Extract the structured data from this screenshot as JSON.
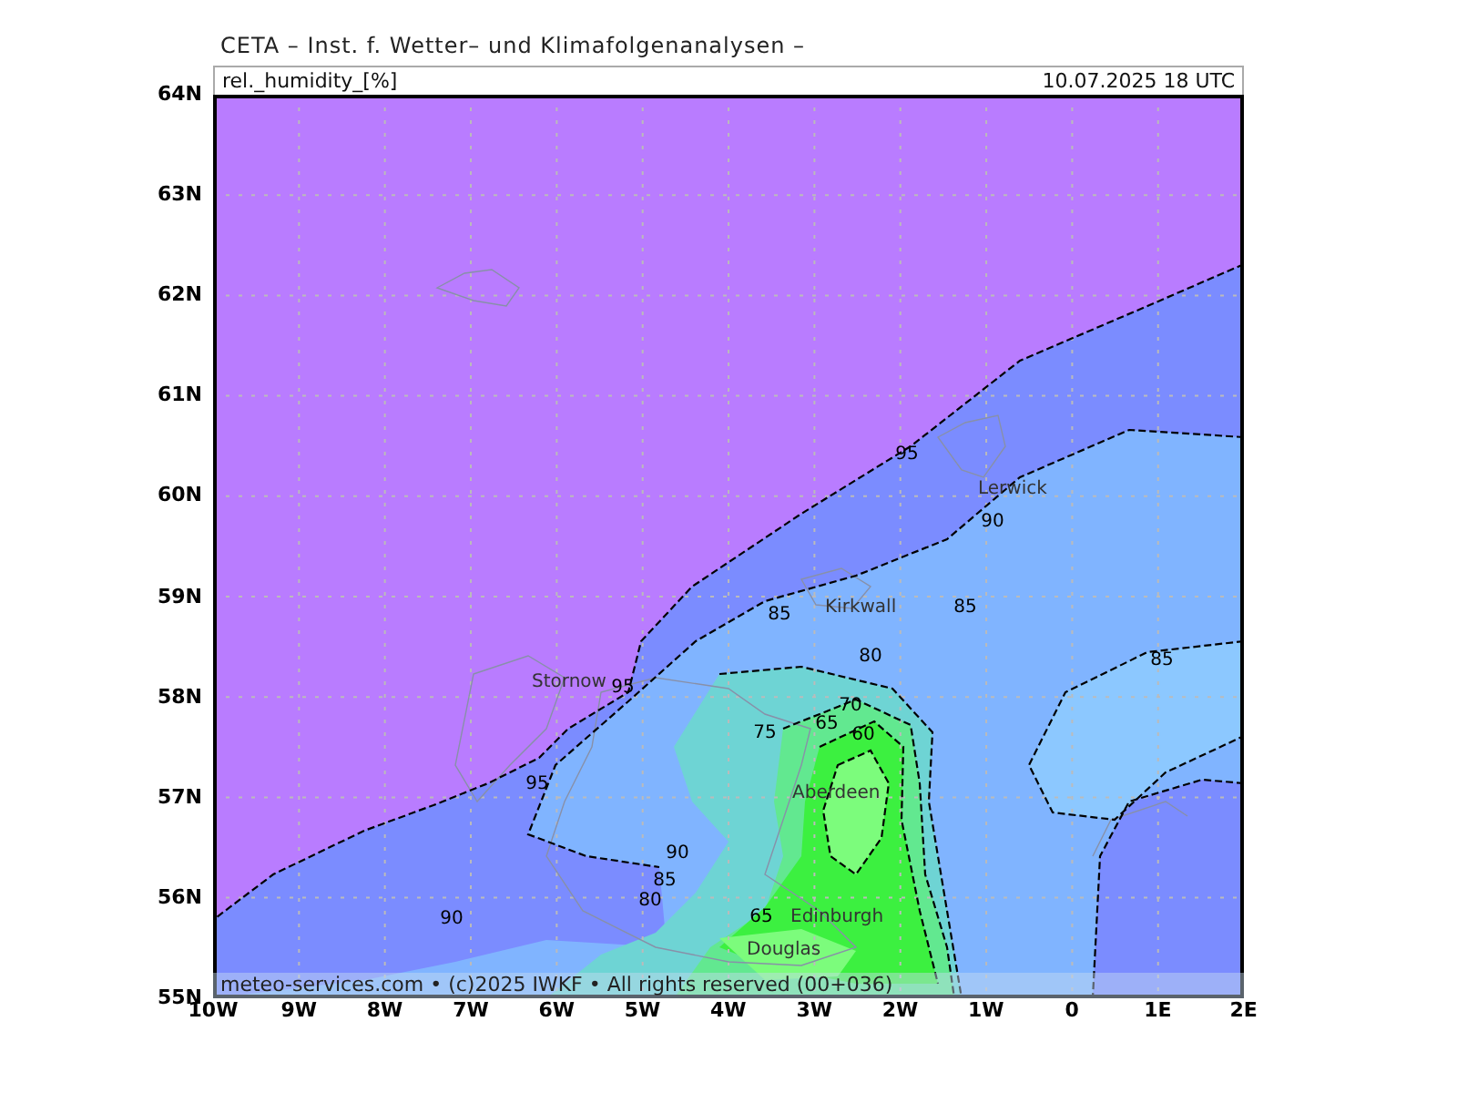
{
  "header": {
    "institute": "CETA – Inst. f. Wetter– und Klimafolgenanalysen –",
    "parameter": "rel._humidity_[%]",
    "valid_time": "10.07.2025 18 UTC"
  },
  "map": {
    "lat_labels": [
      "64N",
      "63N",
      "62N",
      "61N",
      "60N",
      "59N",
      "58N",
      "57N",
      "56N",
      "55N"
    ],
    "lon_labels": [
      "10W",
      "9W",
      "8W",
      "7W",
      "6W",
      "5W",
      "4W",
      "3W",
      "2W",
      "1W",
      "0",
      "1E",
      "2E"
    ],
    "cities": [
      {
        "name": "Lerwick"
      },
      {
        "name": "Kirkwall"
      },
      {
        "name": "Stornow"
      },
      {
        "name": "Aberdeen"
      },
      {
        "name": "Edinburgh"
      },
      {
        "name": "Douglas"
      }
    ],
    "contour_labels": [
      {
        "text": "95"
      },
      {
        "text": "90"
      },
      {
        "text": "85"
      },
      {
        "text": "85"
      },
      {
        "text": "95"
      },
      {
        "text": "85"
      },
      {
        "text": "80"
      },
      {
        "text": "70"
      },
      {
        "text": "65"
      },
      {
        "text": "60"
      },
      {
        "text": "75"
      },
      {
        "text": "95"
      },
      {
        "text": "90"
      },
      {
        "text": "85"
      },
      {
        "text": "80"
      },
      {
        "text": "90"
      },
      {
        "text": "65"
      }
    ],
    "copyright": "meteo-services.com • (c)2025 IWKF • All rights reserved (00+036)"
  }
}
